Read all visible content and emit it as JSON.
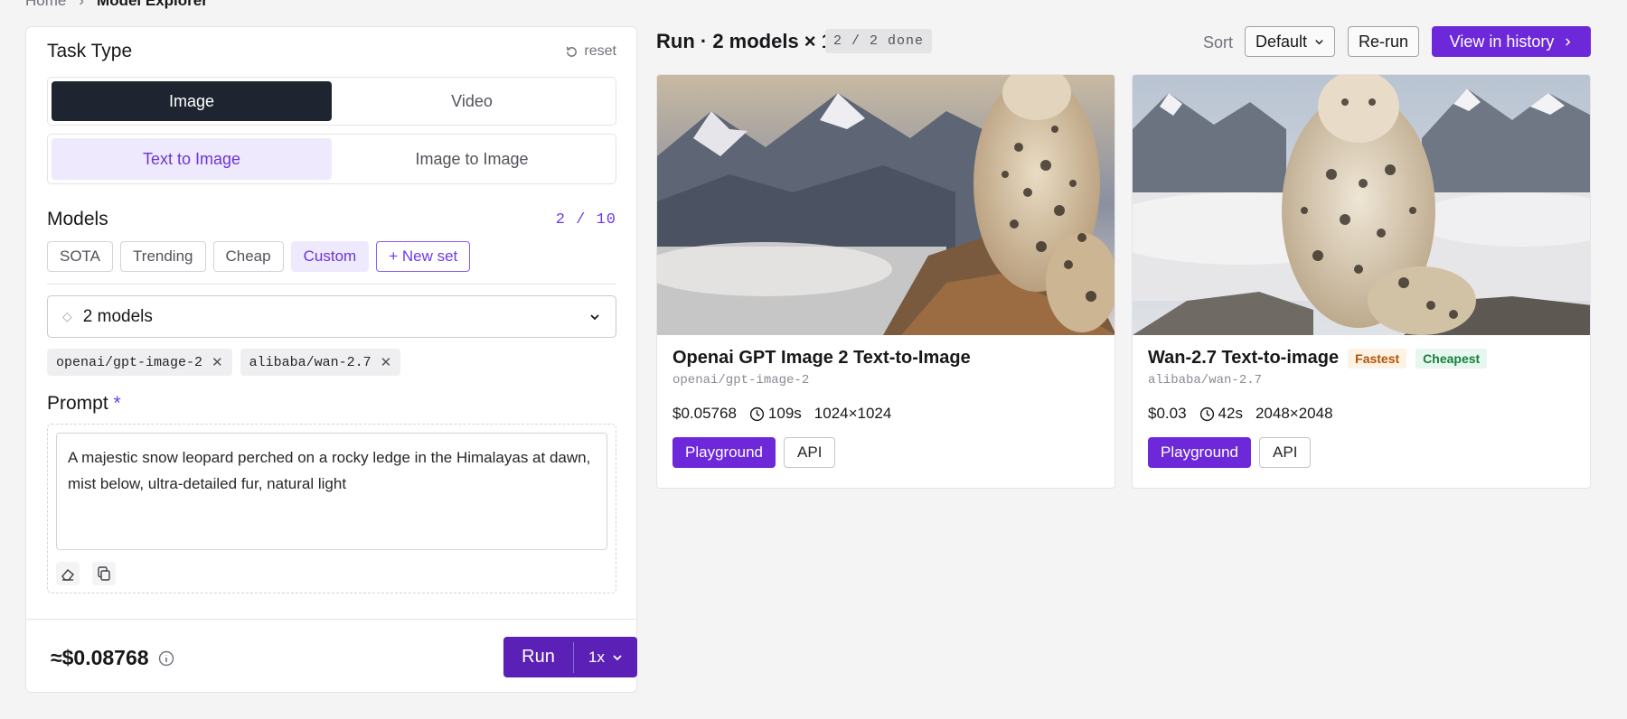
{
  "breadcrumb": {
    "home": "Home",
    "current": "Model Explorer"
  },
  "left": {
    "task_type_title": "Task Type",
    "reset_label": "reset",
    "task_tabs": [
      "Image",
      "Video"
    ],
    "sub_tabs": [
      "Text to Image",
      "Image to Image"
    ],
    "models_title": "Models",
    "models_count": "2 / 10",
    "model_sets": [
      "SOTA",
      "Trending",
      "Cheap",
      "Custom",
      "+ New set"
    ],
    "model_select_label": "2 models",
    "selected_models": [
      "openai/gpt-image-2",
      "alibaba/wan-2.7"
    ],
    "prompt_title": "Prompt",
    "prompt_required": "*",
    "prompt_value": "A majestic snow leopard perched on a rocky ledge in the Himalayas at dawn, mist below, ultra-detailed fur, natural light",
    "estimated_cost": "≈$0.08768",
    "run_label": "Run",
    "multiplier": "1x"
  },
  "run": {
    "title": "Run · 2 models × 1",
    "status": "2 / 2 done",
    "sort_label": "Sort",
    "sort_value": "Default",
    "rerun_label": "Re-run",
    "history_label": "View in history"
  },
  "results": [
    {
      "title": "Openai GPT Image 2 Text-to-Image",
      "slug": "openai/gpt-image-2",
      "badges": [],
      "price": "$0.05768",
      "time": "109s",
      "size": "1024×1024",
      "playground": "Playground",
      "api": "API"
    },
    {
      "title": "Wan-2.7 Text-to-image",
      "slug": "alibaba/wan-2.7",
      "badges": [
        "Fastest",
        "Cheapest"
      ],
      "price": "$0.03",
      "time": "42s",
      "size": "2048×2048",
      "playground": "Playground",
      "api": "API"
    }
  ],
  "colors": {
    "accent": "#6d28d9",
    "dark_tab": "#1e2530",
    "fastest": "#b45309",
    "cheapest": "#16803d"
  }
}
